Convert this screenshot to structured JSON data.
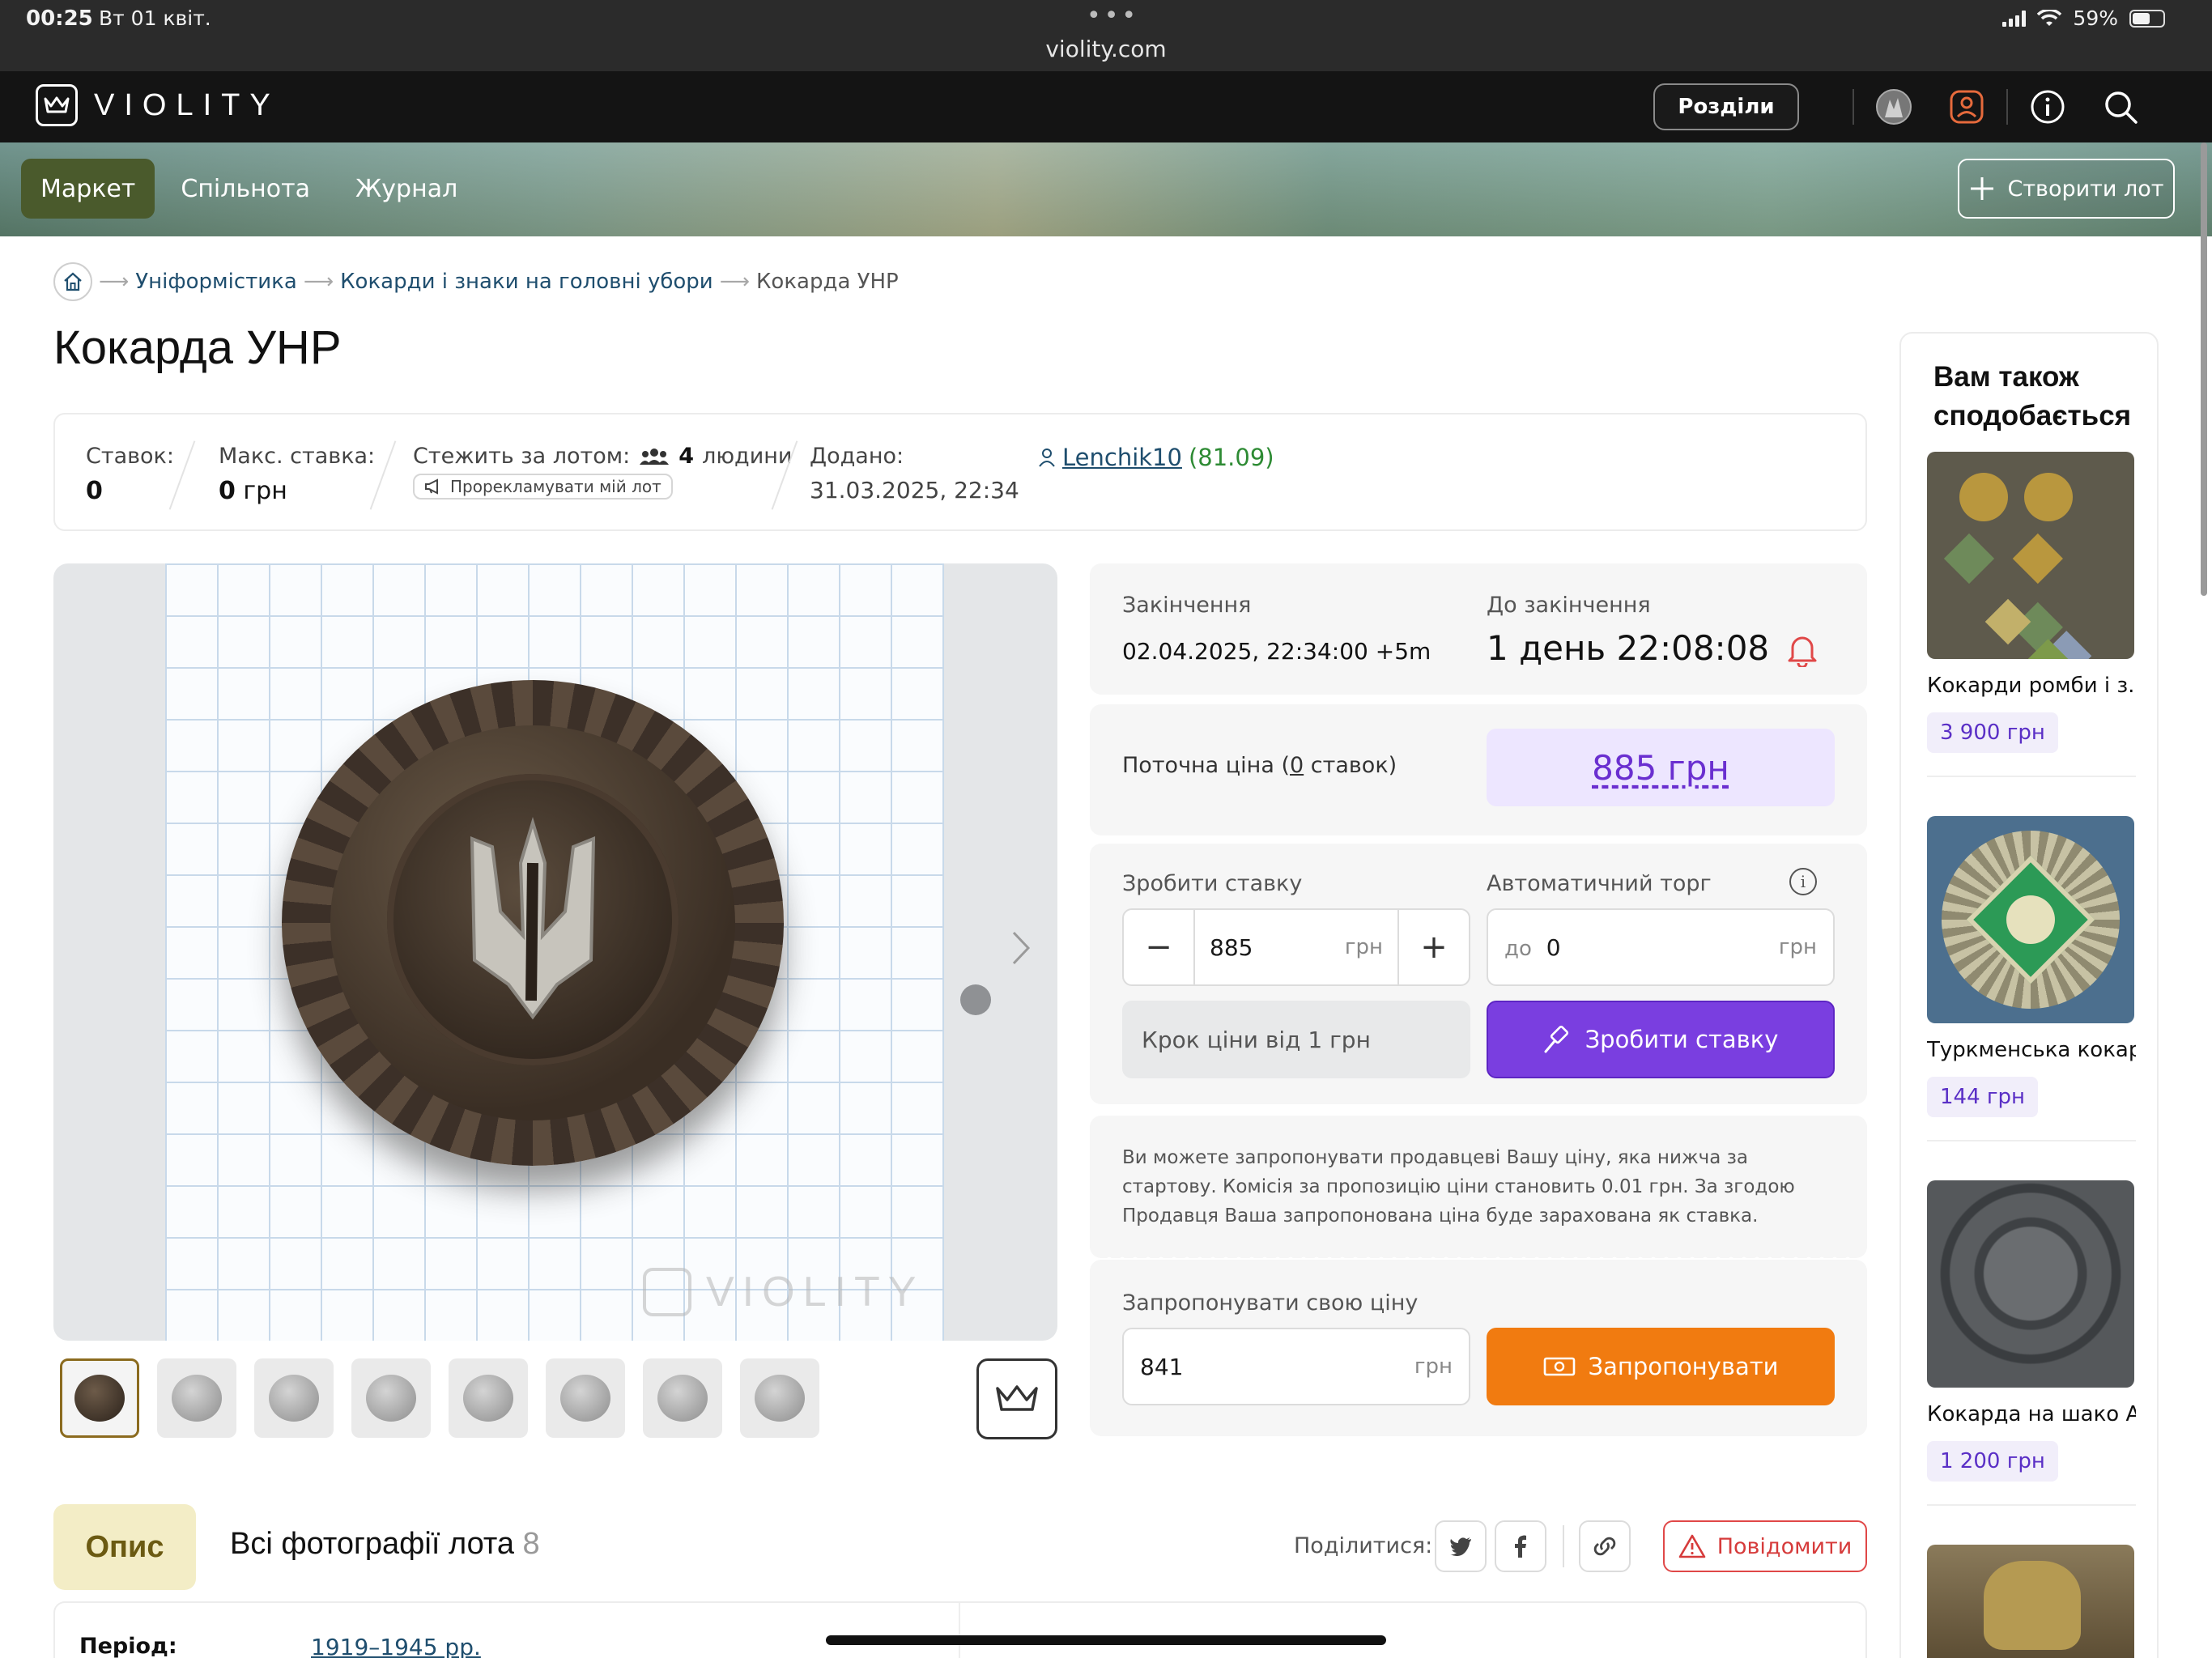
{
  "status": {
    "time": "00:25",
    "date": "Вт 01 квіт.",
    "url": "violity.com",
    "battery": "59%",
    "battery_level": 0.59
  },
  "nav": {
    "brand": "VIOLITY",
    "sections_label": "Розділи"
  },
  "tabs": [
    {
      "label": "Маркет",
      "active": true
    },
    {
      "label": "Спільнота",
      "active": false
    },
    {
      "label": "Журнал",
      "active": false
    }
  ],
  "create_lot": "Створити лот",
  "breadcrumb": {
    "items": [
      "Уніформістика",
      "Кокарди і знаки на головні убори"
    ],
    "current": "Кокарда УНР"
  },
  "title": "Кокарда УНР",
  "stats": {
    "bids_label": "Ставок:",
    "bids_value": "0",
    "max_bid_label": "Макс. ставка:",
    "max_bid_value": "0",
    "max_bid_unit": "грн",
    "watch_label": "Стежить за лотом:",
    "watch_count": "4",
    "watch_unit": "людини",
    "promo": "Прорекламувати мій лот",
    "added_label": "Додано:",
    "added_value": "31.03.2025, 22:34",
    "seller": "Lenchik10",
    "seller_rating": "(81.09)"
  },
  "watermark": "VIOLITY",
  "auction": {
    "end_label": "Закінчення",
    "end_value": "02.04.2025, 22:34:00 +5m",
    "remaining_label": "До закінчення",
    "remaining_value": "1 день 22:08:08",
    "current_label_pre": "Поточна ціна (",
    "current_bids": "0",
    "current_label_post": " ставок)",
    "current_price": "885 грн",
    "bid_label": "Зробити ставку",
    "bid_value": "885",
    "unit": "грн",
    "auto_label": "Автоматичний торг",
    "auto_prefix": "до",
    "auto_value": "0",
    "step_note": "Крок ціни від 1 грн",
    "bid_button": "Зробити ставку",
    "offer_note": "Ви можете запропонувати продавцеві Вашу ціну, яка нижча за стартову. Комісія за пропозицію ціни становить 0.01 грн. За згодою Продавця Ваша запропонована ціна буде зарахована як ставка.",
    "offer_label": "Запропонувати свою ціну",
    "offer_value": "841",
    "offer_button": "Запропонувати"
  },
  "bottom": {
    "desc_tab": "Опис",
    "all_photos": "Всі фотографії лота",
    "photo_count": "8",
    "share_label": "Поділитися:",
    "report": "Повідомити"
  },
  "specs": {
    "period_label": "Період:",
    "period_value": "1919–1945 рр."
  },
  "sidebar": {
    "title": "Вам також сподобається",
    "items": [
      {
        "title": "Кокарди ромби і з...",
        "price": "3 900 грн"
      },
      {
        "title": "Туркменська кокар...",
        "price": "144 грн"
      },
      {
        "title": "Кокарда на шако А...",
        "price": "1 200 грн"
      }
    ]
  }
}
